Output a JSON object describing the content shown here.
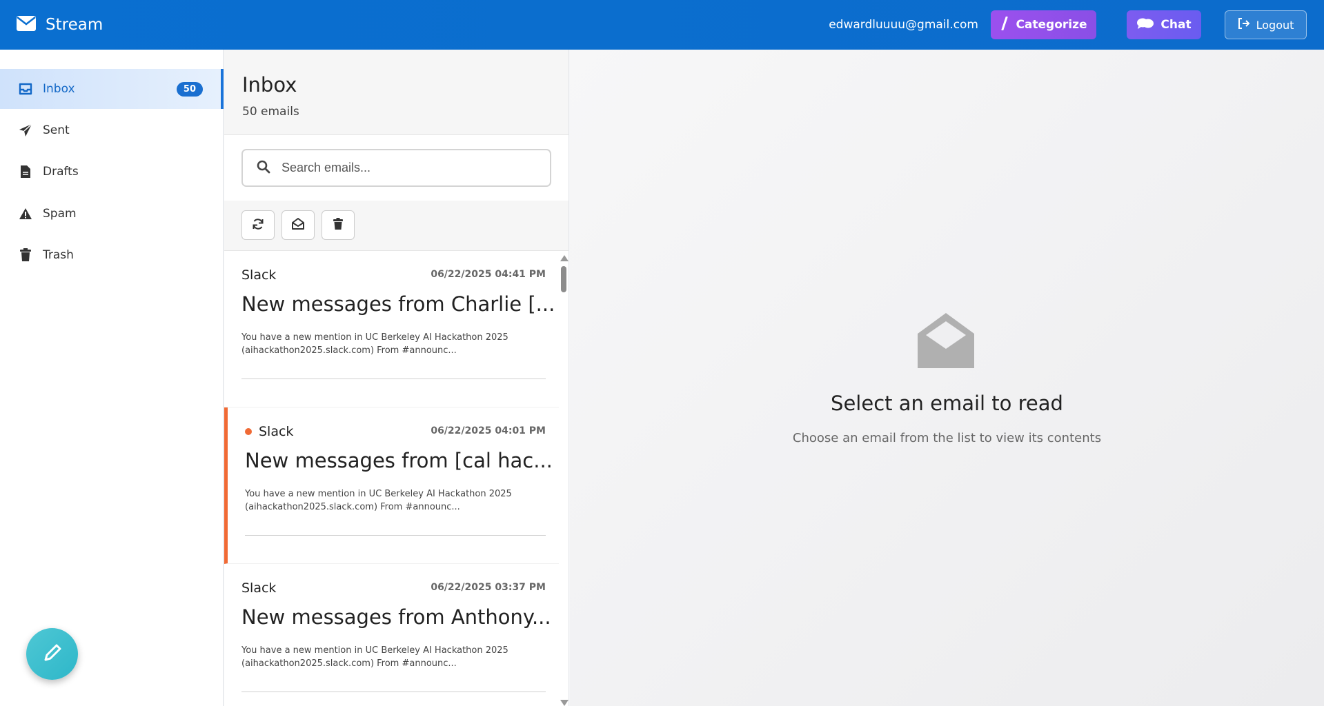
{
  "header": {
    "app_name": "Stream",
    "user_email": "edwardluuuu@gmail.com",
    "categorize_label": "Categorize",
    "chat_label": "Chat",
    "logout_label": "Logout",
    "brand_color": "#0a6fd0"
  },
  "sidebar": {
    "items": [
      {
        "label": "Inbox",
        "icon": "inbox-icon",
        "badge": "50"
      },
      {
        "label": "Sent",
        "icon": "paper-plane-icon"
      },
      {
        "label": "Drafts",
        "icon": "file-icon"
      },
      {
        "label": "Spam",
        "icon": "warning-icon"
      },
      {
        "label": "Trash",
        "icon": "trash-icon"
      }
    ],
    "compose_icon": "pencil-icon"
  },
  "list": {
    "title": "Inbox",
    "count": "50 emails",
    "search_placeholder": "Search emails...",
    "toolbar": [
      "refresh-icon",
      "mark-read-icon",
      "delete-icon"
    ],
    "emails": [
      {
        "from": "Slack",
        "date": "06/22/2025 04:41 PM",
        "subject": "New messages from Charlie [...",
        "preview": "You have a new mention in UC Berkeley AI Hackathon 2025 (aihackathon2025.slack.com) From #announc...",
        "unread": false
      },
      {
        "from": "Slack",
        "date": "06/22/2025 04:01 PM",
        "subject": "New messages from [cal hac...",
        "preview": "You have a new mention in UC Berkeley AI Hackathon 2025 (aihackathon2025.slack.com) From #announc...",
        "unread": true
      },
      {
        "from": "Slack",
        "date": "06/22/2025 03:37 PM",
        "subject": "New messages from Anthony...",
        "preview": "You have a new mention in UC Berkeley AI Hackathon 2025 (aihackathon2025.slack.com) From #announc...",
        "unread": false
      }
    ]
  },
  "reader": {
    "empty_title": "Select an email to read",
    "empty_subtitle": "Choose an email from the list to view its contents",
    "icon": "envelope-open-icon"
  }
}
